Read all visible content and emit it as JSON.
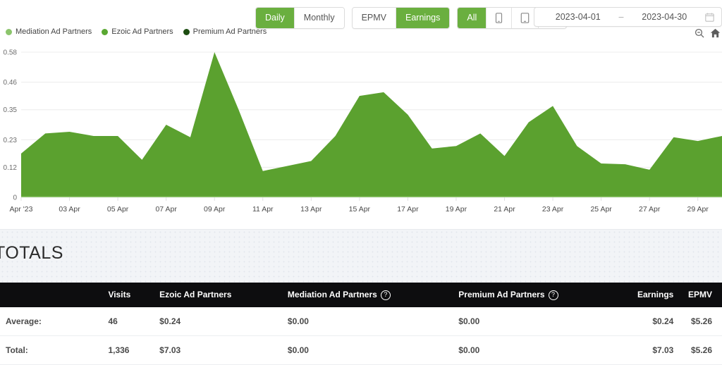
{
  "toolbar": {
    "interval_group": [
      {
        "label": "Daily",
        "active": true
      },
      {
        "label": "Monthly",
        "active": false
      }
    ],
    "metric_group": [
      {
        "label": "EPMV",
        "active": false
      },
      {
        "label": "Earnings",
        "active": true
      }
    ],
    "device_group": [
      {
        "label": "All",
        "icon": "",
        "active": true
      },
      {
        "label": "",
        "icon": "phone-icon",
        "active": false
      },
      {
        "label": "",
        "icon": "tablet-icon",
        "active": false
      },
      {
        "label": "",
        "icon": "desktop-icon",
        "active": false
      }
    ],
    "date_range": {
      "start": "2023-04-01",
      "separator": "–",
      "end": "2023-04-30",
      "calendar_icon": "calendar-icon"
    },
    "mini_icons": [
      "zoom-out-icon",
      "home-icon"
    ]
  },
  "legend": {
    "items": [
      {
        "label": "Mediation Ad Partners",
        "color": "#8cc56c"
      },
      {
        "label": "Ezoic Ad Partners",
        "color": "#5aa832"
      },
      {
        "label": "Premium Ad Partners",
        "color": "#1d4d12"
      }
    ]
  },
  "totals": {
    "title": "TOTALS",
    "columns": [
      "",
      "Visits",
      "Ezoic Ad Partners",
      "Mediation Ad Partners",
      "Premium Ad Partners",
      "Earnings",
      "EPMV"
    ],
    "column_help": [
      false,
      false,
      false,
      true,
      true,
      false,
      false
    ],
    "rows": [
      {
        "label": "Average:",
        "visits": "46",
        "ezoic": "$0.24",
        "mediation": "$0.00",
        "premium": "$0.00",
        "earnings": "$0.24",
        "epmv": "$5.26"
      },
      {
        "label": "Total:",
        "visits": "1,336",
        "ezoic": "$7.03",
        "mediation": "$0.00",
        "premium": "$0.00",
        "earnings": "$7.03",
        "epmv": "$5.26"
      }
    ]
  },
  "chart_data": {
    "type": "area",
    "title": "",
    "xlabel": "",
    "ylabel": "",
    "ylim": [
      0,
      0.58
    ],
    "grid": true,
    "legend_position": "top-left",
    "y_ticks": [
      "0",
      "0.12",
      "0.23",
      "0.35",
      "0.46",
      "0.58"
    ],
    "y_tick_values": [
      0,
      0.12,
      0.23,
      0.35,
      0.46,
      0.58
    ],
    "x_tick_labels": [
      "Apr '23",
      "03 Apr",
      "05 Apr",
      "07 Apr",
      "09 Apr",
      "11 Apr",
      "13 Apr",
      "15 Apr",
      "17 Apr",
      "19 Apr",
      "21 Apr",
      "23 Apr",
      "25 Apr",
      "27 Apr",
      "29 Apr"
    ],
    "x": [
      "Apr 01",
      "Apr 02",
      "Apr 03",
      "Apr 04",
      "Apr 05",
      "Apr 06",
      "Apr 07",
      "Apr 08",
      "Apr 09",
      "Apr 10",
      "Apr 11",
      "Apr 12",
      "Apr 13",
      "Apr 14",
      "Apr 15",
      "Apr 16",
      "Apr 17",
      "Apr 18",
      "Apr 19",
      "Apr 20",
      "Apr 21",
      "Apr 22",
      "Apr 23",
      "Apr 24",
      "Apr 25",
      "Apr 26",
      "Apr 27",
      "Apr 28",
      "Apr 29",
      "Apr 30"
    ],
    "series": [
      {
        "name": "Ezoic Ad Partners",
        "color": "#5ba12f",
        "values": [
          0.175,
          0.255,
          0.262,
          0.245,
          0.245,
          0.15,
          0.29,
          0.24,
          0.58,
          0.35,
          0.105,
          0.125,
          0.145,
          0.245,
          0.405,
          0.42,
          0.33,
          0.195,
          0.205,
          0.255,
          0.165,
          0.3,
          0.365,
          0.205,
          0.135,
          0.132,
          0.11,
          0.24,
          0.225,
          0.245
        ]
      },
      {
        "name": "Mediation Ad Partners",
        "color": "#8cc56c",
        "values": [
          0.004,
          0.004,
          0.004,
          0.004,
          0.004,
          0.004,
          0.004,
          0.004,
          0.004,
          0.004,
          0.004,
          0.004,
          0.004,
          0.004,
          0.004,
          0.004,
          0.004,
          0.004,
          0.004,
          0.004,
          0.004,
          0.004,
          0.004,
          0.004,
          0.004,
          0.004,
          0.004,
          0.004,
          0.004,
          0.004
        ]
      },
      {
        "name": "Premium Ad Partners",
        "color": "#1d4d12",
        "values": [
          0,
          0,
          0,
          0,
          0,
          0,
          0,
          0,
          0,
          0,
          0,
          0,
          0,
          0,
          0,
          0,
          0,
          0,
          0,
          0,
          0,
          0,
          0,
          0,
          0,
          0,
          0,
          0,
          0,
          0
        ]
      }
    ]
  }
}
